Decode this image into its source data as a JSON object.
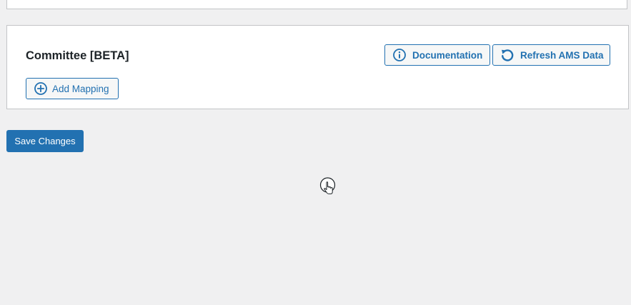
{
  "committee_section": {
    "title": "Committee [BETA]",
    "documentation_label": "Documentation",
    "refresh_label": "Refresh AMS Data",
    "add_mapping_label": "Add Mapping"
  },
  "footer": {
    "save_label": "Save Changes"
  },
  "icons": {
    "documentation": "info-circle-icon",
    "refresh": "refresh-icon",
    "add_mapping": "plus-circle-icon",
    "cursor": "hand-pointer-cursor-icon"
  },
  "colors": {
    "accent": "#2271b1",
    "page_background": "#f0f0f1",
    "card_border": "#c3c4c7",
    "title_text": "#1d2327"
  }
}
